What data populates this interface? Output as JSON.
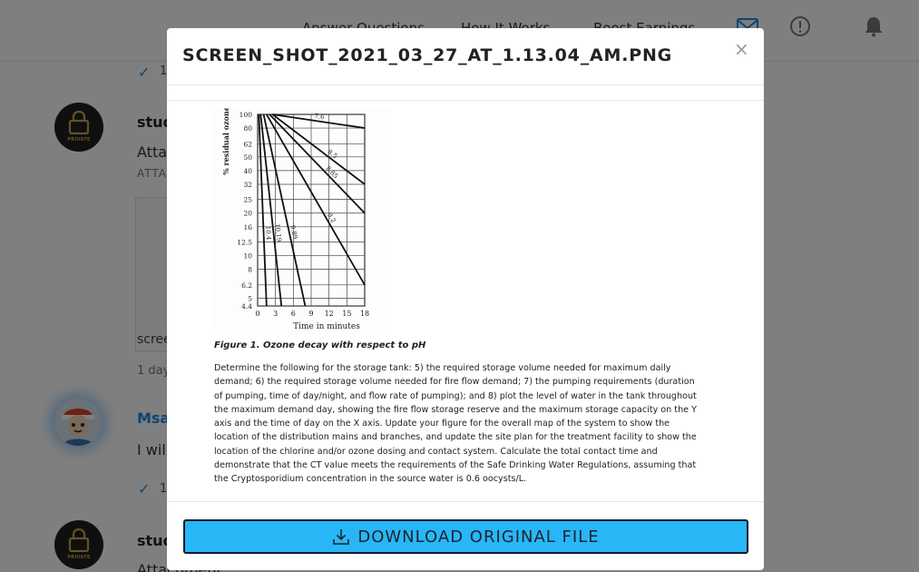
{
  "nav": {
    "answer_questions": "Answer Questions",
    "how_it_works": "How It Works",
    "boost_earnings": "Boost Earnings"
  },
  "feed": {
    "item1_check_count": "1",
    "post1": {
      "name": "stud",
      "avatar_label": "PRIVATE",
      "text": "Attac",
      "attach_label": "ATTA",
      "file_name": "scree",
      "time": "1 day"
    },
    "post2": {
      "name": "Msar",
      "text": "I will",
      "check_count": "1"
    },
    "post3": {
      "name": "stud",
      "avatar_label": "PRIVATE",
      "text": "Attachment"
    }
  },
  "modal": {
    "title": "SCREEN_SHOT_2021_03_27_AT_1.13.04_AM.PNG",
    "close": "×",
    "figure_caption": "Figure 1. Ozone decay with respect to pH",
    "paragraph": "Determine the following for the storage tank: 5) the required storage volume needed for maximum daily demand; 6) the required storage volume needed for fire flow demand; 7) the pumping requirements (duration of pumping, time of day/night, and flow rate of pumping); and 8) plot the level of water in the tank throughout the maximum demand day, showing the fire flow storage reserve and the maximum storage capacity on the Y axis and the time of day on the X axis. Update your figure for the overall map of the system to show the location of the distribution mains and branches, and update the site plan for the treatment facility to show the location of the chlorine and/or ozone dosing and contact system. Calculate the total contact time and demonstrate that the CT value meets the requirements of the Safe Drinking Water Regulations, assuming that the Cryptosporidium concentration in the source water is 0.6 oocysts/L.",
    "download_label": "DOWNLOAD ORIGINAL FILE"
  },
  "colors": {
    "accent": "#1a8ae6",
    "download_button": "#29b6f6",
    "private_gold": "#c8a24a"
  },
  "icons": {
    "mail": "mail-icon",
    "alert": "alert-circle-icon",
    "bell": "bell-icon",
    "lock": "lock-icon",
    "download": "download-icon",
    "check": "check-icon"
  },
  "chart_data": {
    "type": "line",
    "xlabel": "Time in minutes",
    "ylabel": "% residual ozone",
    "x_ticks": [
      0,
      3,
      6,
      9,
      12,
      15,
      18
    ],
    "y_ticks": [
      100,
      80,
      62,
      50,
      40,
      32,
      25,
      20,
      16,
      12.5,
      10,
      8,
      6.2,
      5,
      4.4
    ],
    "xlim": [
      0,
      18
    ],
    "ylim": [
      4.4,
      100
    ],
    "yscale": "log",
    "grid": true,
    "series": [
      {
        "name": "7.6",
        "points": [
          [
            2.5,
            100
          ],
          [
            18,
            80
          ]
        ]
      },
      {
        "name": "8.5",
        "points": [
          [
            2.5,
            100
          ],
          [
            18,
            32
          ]
        ]
      },
      {
        "name": "8.85",
        "points": [
          [
            2,
            100
          ],
          [
            18,
            20
          ]
        ]
      },
      {
        "name": "9.2",
        "points": [
          [
            1.5,
            100
          ],
          [
            18,
            6.2
          ]
        ]
      },
      {
        "name": "9.89",
        "points": [
          [
            1,
            100
          ],
          [
            8,
            4.4
          ]
        ]
      },
      {
        "name": "10.19",
        "points": [
          [
            0.5,
            100
          ],
          [
            4,
            4.4
          ]
        ]
      },
      {
        "name": "10.4",
        "points": [
          [
            0.2,
            100
          ],
          [
            1.5,
            4.4
          ]
        ]
      }
    ]
  }
}
